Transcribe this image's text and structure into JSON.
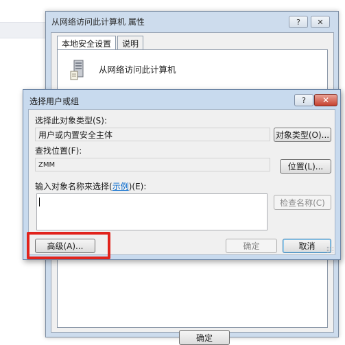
{
  "properties_window": {
    "title": "从网络访问此计算机 属性",
    "help_label": "?",
    "close_label": "✕",
    "tabs": [
      {
        "label": "本地安全设置"
      },
      {
        "label": "说明"
      }
    ],
    "policy_name": "从网络访问此计算机",
    "ok_label": "确定"
  },
  "select_dialog": {
    "title": "选择用户或组",
    "help_label": "?",
    "close_label": "✕",
    "object_type_label": "选择此对象类型(S):",
    "object_type_value": "用户或内置安全主体",
    "object_types_button": "对象类型(O)...",
    "location_label": "查找位置(F):",
    "location_value": "ZMM",
    "locations_button": "位置(L)...",
    "names_label_prefix": "输入对象名称来选择(",
    "names_label_link": "示例",
    "names_label_suffix": ")(E):",
    "names_value": "",
    "check_names_button": "检查名称(C)",
    "advanced_button": "高级(A)...",
    "ok_button": "确定",
    "cancel_button": "取消"
  },
  "highlight_color": "#e1231c"
}
